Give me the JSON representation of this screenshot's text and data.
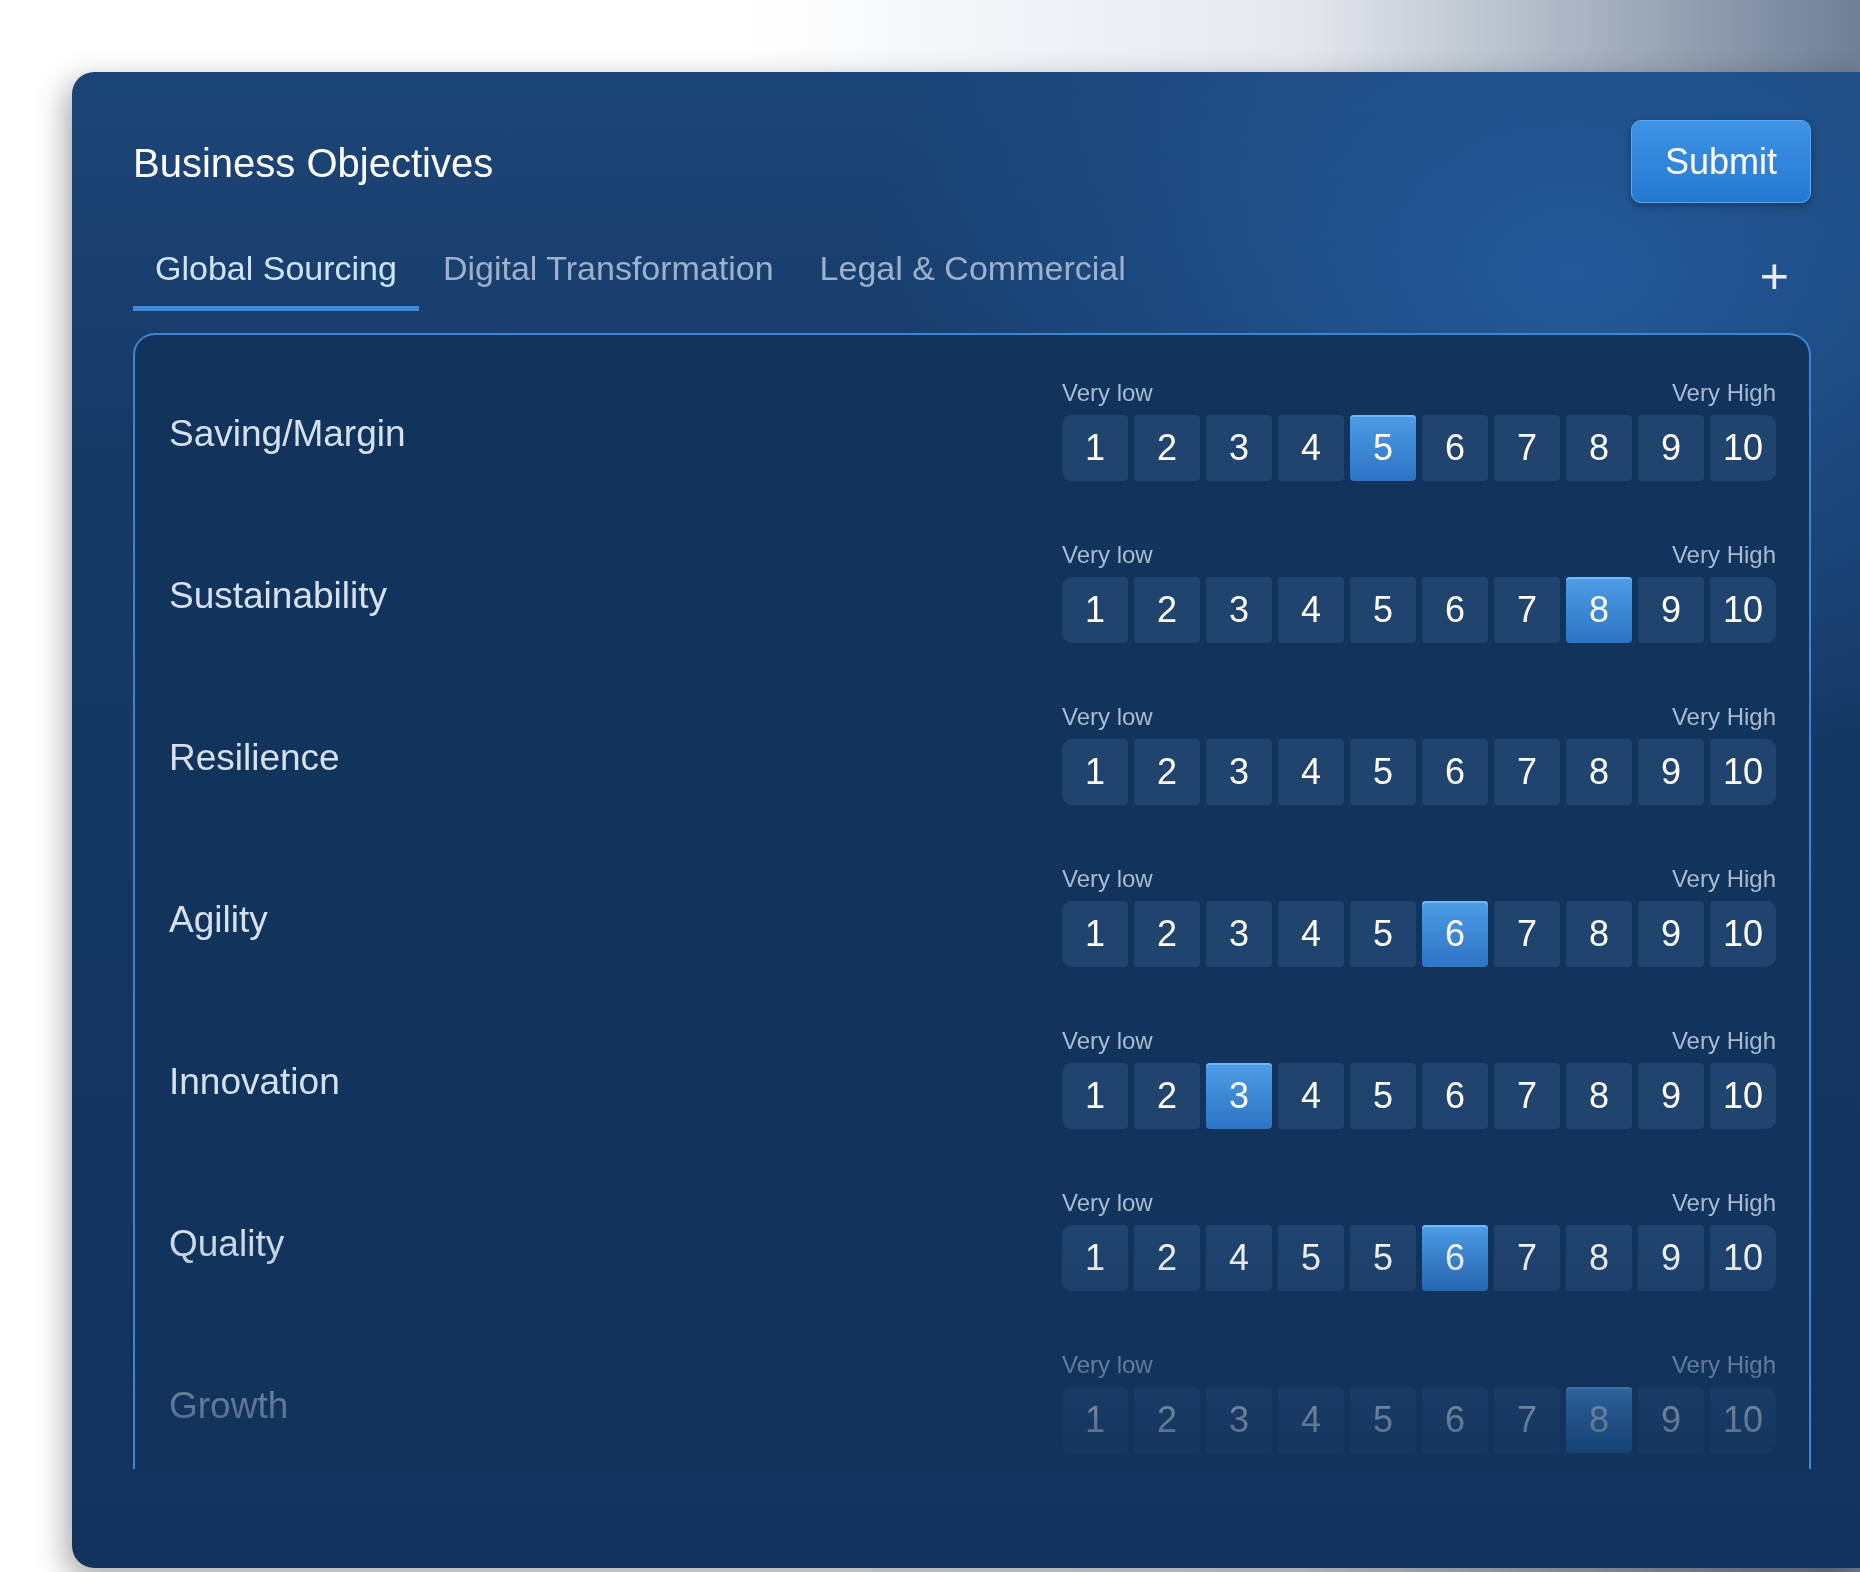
{
  "header": {
    "title": "Business Objectives",
    "submit": "Submit"
  },
  "tabs": [
    {
      "label": "Global Sourcing",
      "selected": true
    },
    {
      "label": "Digital Transformation",
      "selected": false
    },
    {
      "label": "Legal & Commercial",
      "selected": false
    }
  ],
  "add_tab": "+",
  "objectives": [
    {
      "label": "Saving/Margin",
      "low": "Very low",
      "high": "Very High",
      "options": [
        {
          "label": "1",
          "selected": false
        },
        {
          "label": "2",
          "selected": false
        },
        {
          "label": "3",
          "selected": false
        },
        {
          "label": "4",
          "selected": false
        },
        {
          "label": "5",
          "selected": true
        },
        {
          "label": "6",
          "selected": false
        },
        {
          "label": "7",
          "selected": false
        },
        {
          "label": "8",
          "selected": false
        },
        {
          "label": "9",
          "selected": false
        },
        {
          "label": "10",
          "selected": false
        }
      ]
    },
    {
      "label": "Sustainability",
      "low": "Very low",
      "high": "Very High",
      "options": [
        {
          "label": "1",
          "selected": false
        },
        {
          "label": "2",
          "selected": false
        },
        {
          "label": "3",
          "selected": false
        },
        {
          "label": "4",
          "selected": false
        },
        {
          "label": "5",
          "selected": false
        },
        {
          "label": "6",
          "selected": false
        },
        {
          "label": "7",
          "selected": false
        },
        {
          "label": "8",
          "selected": true
        },
        {
          "label": "9",
          "selected": false
        },
        {
          "label": "10",
          "selected": false
        }
      ]
    },
    {
      "label": "Resilience",
      "low": "Very low",
      "high": "Very High",
      "options": [
        {
          "label": "1",
          "selected": false
        },
        {
          "label": "2",
          "selected": false
        },
        {
          "label": "3",
          "selected": false
        },
        {
          "label": "4",
          "selected": false
        },
        {
          "label": "5",
          "selected": false
        },
        {
          "label": "6",
          "selected": false
        },
        {
          "label": "7",
          "selected": false
        },
        {
          "label": "8",
          "selected": false
        },
        {
          "label": "9",
          "selected": false
        },
        {
          "label": "10",
          "selected": false
        }
      ]
    },
    {
      "label": "Agility",
      "low": "Very low",
      "high": "Very High",
      "options": [
        {
          "label": "1",
          "selected": false
        },
        {
          "label": "2",
          "selected": false
        },
        {
          "label": "3",
          "selected": false
        },
        {
          "label": "4",
          "selected": false
        },
        {
          "label": "5",
          "selected": false
        },
        {
          "label": "6",
          "selected": true
        },
        {
          "label": "7",
          "selected": false
        },
        {
          "label": "8",
          "selected": false
        },
        {
          "label": "9",
          "selected": false
        },
        {
          "label": "10",
          "selected": false
        }
      ]
    },
    {
      "label": "Innovation",
      "low": "Very low",
      "high": "Very High",
      "options": [
        {
          "label": "1",
          "selected": false
        },
        {
          "label": "2",
          "selected": false
        },
        {
          "label": "3",
          "selected": true
        },
        {
          "label": "4",
          "selected": false
        },
        {
          "label": "5",
          "selected": false
        },
        {
          "label": "6",
          "selected": false
        },
        {
          "label": "7",
          "selected": false
        },
        {
          "label": "8",
          "selected": false
        },
        {
          "label": "9",
          "selected": false
        },
        {
          "label": "10",
          "selected": false
        }
      ]
    },
    {
      "label": "Quality",
      "low": "Very low",
      "high": "Very High",
      "options": [
        {
          "label": "1",
          "selected": false
        },
        {
          "label": "2",
          "selected": false
        },
        {
          "label": "4",
          "selected": false
        },
        {
          "label": "5",
          "selected": false
        },
        {
          "label": "5",
          "selected": false
        },
        {
          "label": "6",
          "selected": true
        },
        {
          "label": "7",
          "selected": false
        },
        {
          "label": "8",
          "selected": false
        },
        {
          "label": "9",
          "selected": false
        },
        {
          "label": "10",
          "selected": false
        }
      ]
    },
    {
      "label": "Growth",
      "low": "Very low",
      "high": "Very High",
      "options": [
        {
          "label": "1",
          "selected": false
        },
        {
          "label": "2",
          "selected": false
        },
        {
          "label": "3",
          "selected": false
        },
        {
          "label": "4",
          "selected": false
        },
        {
          "label": "5",
          "selected": false
        },
        {
          "label": "6",
          "selected": false
        },
        {
          "label": "7",
          "selected": false
        },
        {
          "label": "8",
          "selected": true
        },
        {
          "label": "9",
          "selected": false
        },
        {
          "label": "10",
          "selected": false
        }
      ]
    }
  ]
}
